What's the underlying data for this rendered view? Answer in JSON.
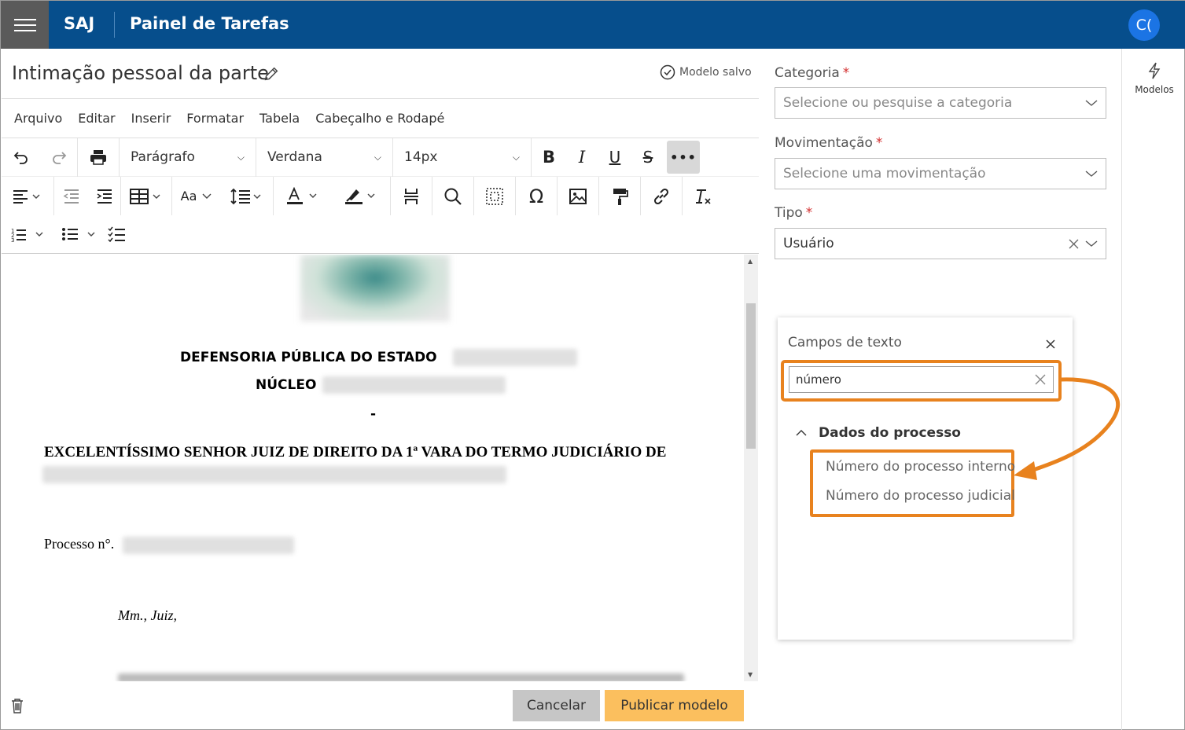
{
  "header": {
    "brand": "SAJ",
    "title": "Painel de Tarefas",
    "avatar_initials": "C("
  },
  "document": {
    "title": "Intimação pessoal da parte",
    "saved_status": "Modelo salvo"
  },
  "menu": [
    "Arquivo",
    "Editar",
    "Inserir",
    "Formatar",
    "Tabela",
    "Cabeçalho e Rodapé"
  ],
  "toolbar": {
    "block_format": "Parágrafo",
    "font_family": "Verdana",
    "font_size": "14px",
    "case_label": "Aa"
  },
  "doc_content": {
    "line1": "DEFENSORIA PÚBLICA DO ESTADO",
    "line2": "NÚCLEO",
    "dash": "-",
    "line3": "EXCELENTÍSSIMO SENHOR JUIZ DE DIREITO DA 1ª VARA DO TERMO JUDICIÁRIO DE",
    "process": "Processo n°.",
    "salutation": "Mm., Juiz,"
  },
  "footer": {
    "cancel": "Cancelar",
    "publish": "Publicar modelo"
  },
  "form": {
    "categoria_label": "Categoria",
    "categoria_placeholder": "Selecione ou pesquise a categoria",
    "movimentacao_label": "Movimentação",
    "movimentacao_placeholder": "Selecione uma movimentação",
    "tipo_label": "Tipo",
    "tipo_value": "Usuário",
    "required_mark": "*"
  },
  "side": {
    "models_label": "Modelos"
  },
  "popover": {
    "title": "Campos de texto",
    "search_value": "número",
    "group": "Dados do processo",
    "results": [
      "Número do processo interno",
      "Número do processo judicial"
    ]
  },
  "colors": {
    "header_bg": "#064e8c",
    "highlight": "#e8821e",
    "publish_bg": "#fbbf5e"
  }
}
